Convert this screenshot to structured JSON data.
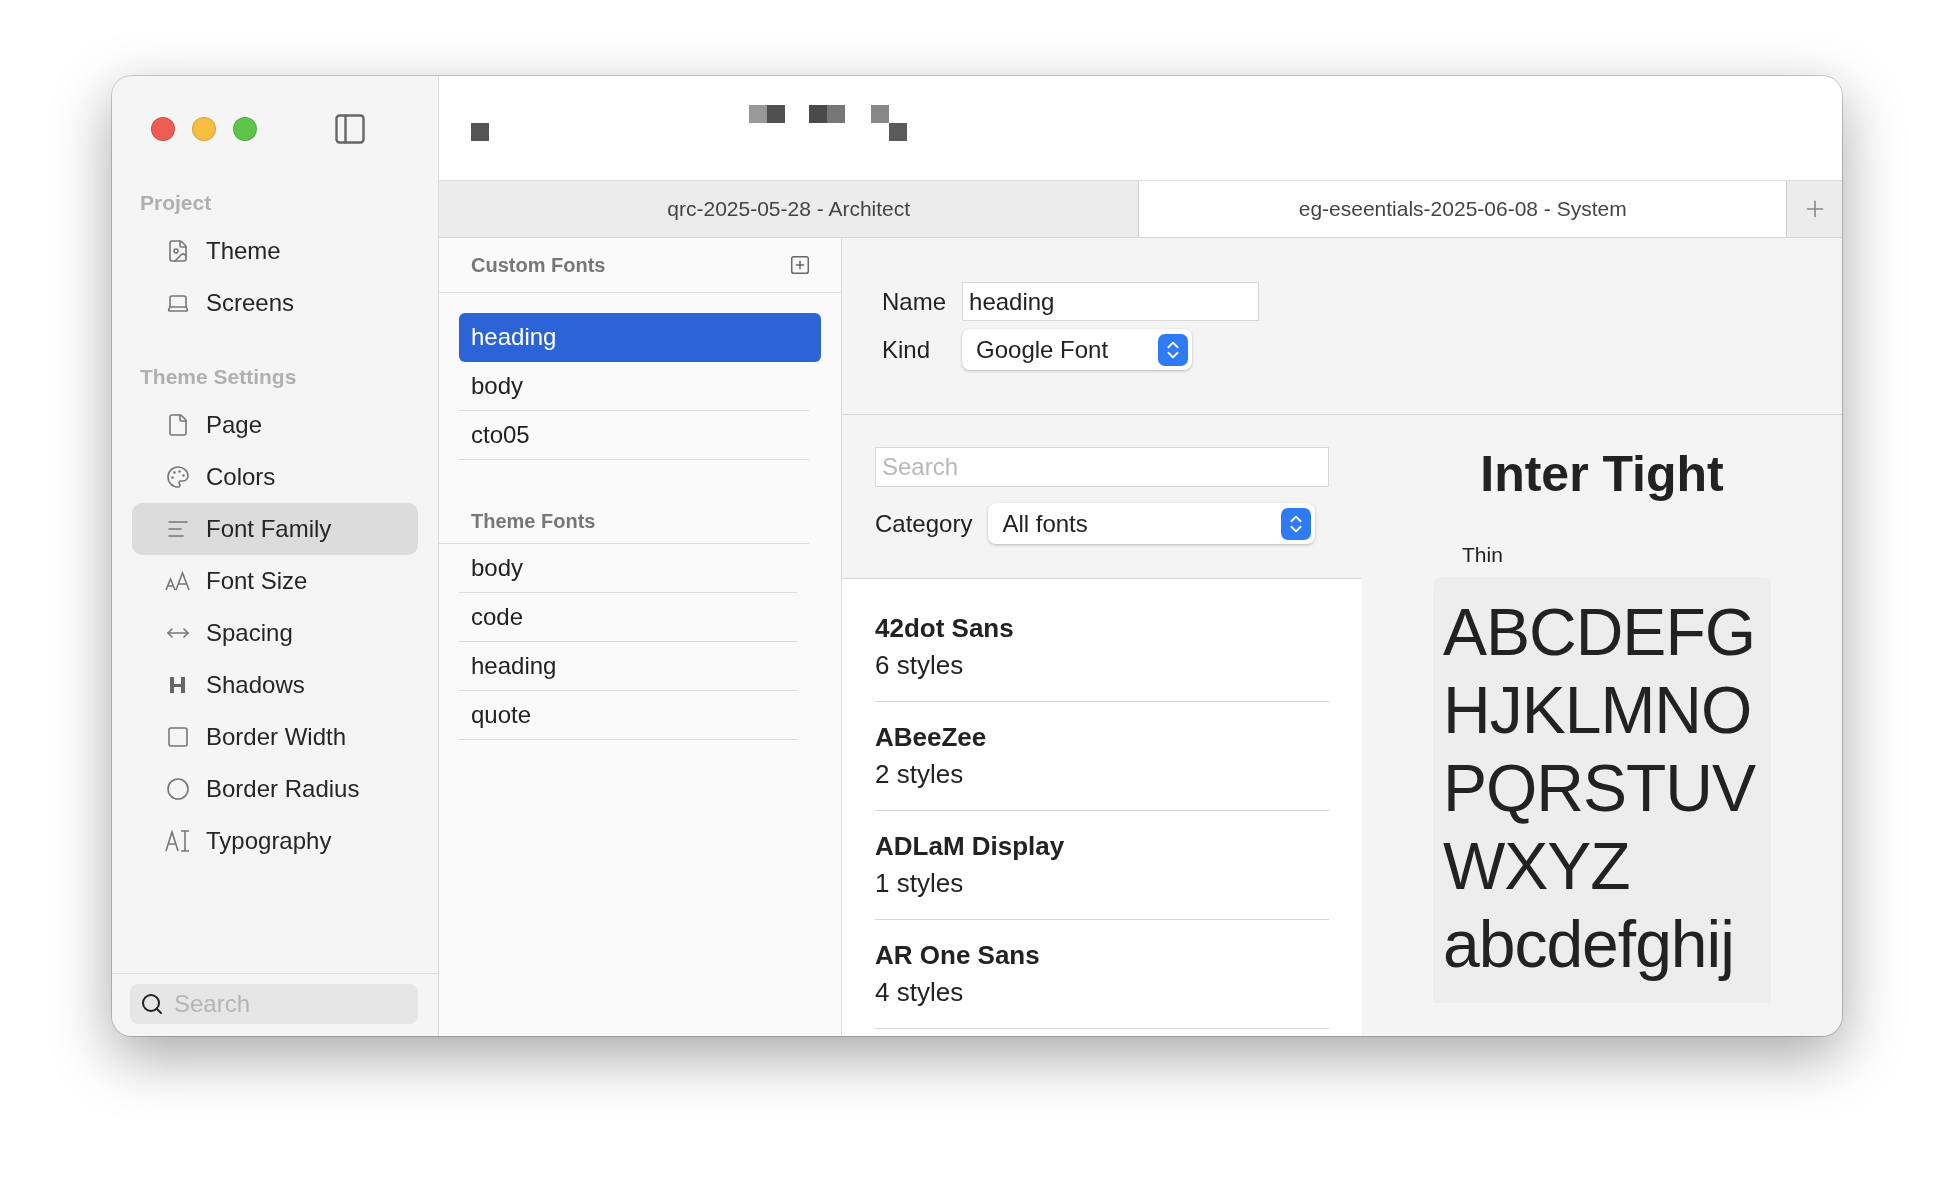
{
  "tabs": [
    {
      "label": "qrc-2025-05-28 - Architect",
      "selected": false
    },
    {
      "label": "eg-eseentials-2025-06-08 - System",
      "selected": true
    }
  ],
  "sidebar": {
    "sections": [
      {
        "title": "Project",
        "items": [
          {
            "label": "Theme",
            "selected": false
          },
          {
            "label": "Screens",
            "selected": false
          }
        ]
      },
      {
        "title": "Theme Settings",
        "items": [
          {
            "label": "Page",
            "selected": false
          },
          {
            "label": "Colors",
            "selected": false
          },
          {
            "label": "Font Family",
            "selected": true
          },
          {
            "label": "Font Size",
            "selected": false
          },
          {
            "label": "Spacing",
            "selected": false
          },
          {
            "label": "Shadows",
            "selected": false
          },
          {
            "label": "Border Width",
            "selected": false
          },
          {
            "label": "Border Radius",
            "selected": false
          },
          {
            "label": "Typography",
            "selected": false
          }
        ]
      }
    ],
    "search": {
      "placeholder": "Search"
    }
  },
  "fonts_panel": {
    "custom_title": "Custom Fonts",
    "custom_fonts": [
      {
        "label": "heading",
        "selected": true
      },
      {
        "label": "body",
        "selected": false
      },
      {
        "label": "cto05",
        "selected": false
      }
    ],
    "theme_title": "Theme Fonts",
    "theme_fonts": [
      {
        "label": "body",
        "selected": false
      },
      {
        "label": "code",
        "selected": false
      },
      {
        "label": "heading",
        "selected": false
      },
      {
        "label": "quote",
        "selected": false
      }
    ]
  },
  "detail": {
    "name_label": "Name",
    "name_value": "heading",
    "kind_label": "Kind",
    "kind_value": "Google Font"
  },
  "browser": {
    "search": {
      "placeholder": "Search"
    },
    "category_label": "Category",
    "category_value": "All fonts",
    "fonts": [
      {
        "name": "42dot Sans",
        "styles": "6 styles"
      },
      {
        "name": "ABeeZee",
        "styles": "2 styles"
      },
      {
        "name": "ADLaM Display",
        "styles": "1 styles"
      },
      {
        "name": "AR One Sans",
        "styles": "4 styles"
      }
    ]
  },
  "preview": {
    "title": "Inter Tight",
    "weight_label": "Thin",
    "sample_lines": [
      "ABCDEFG",
      "HJKLMNO",
      "PQRSTUV",
      "WXYZ",
      "abcdefghij"
    ]
  }
}
